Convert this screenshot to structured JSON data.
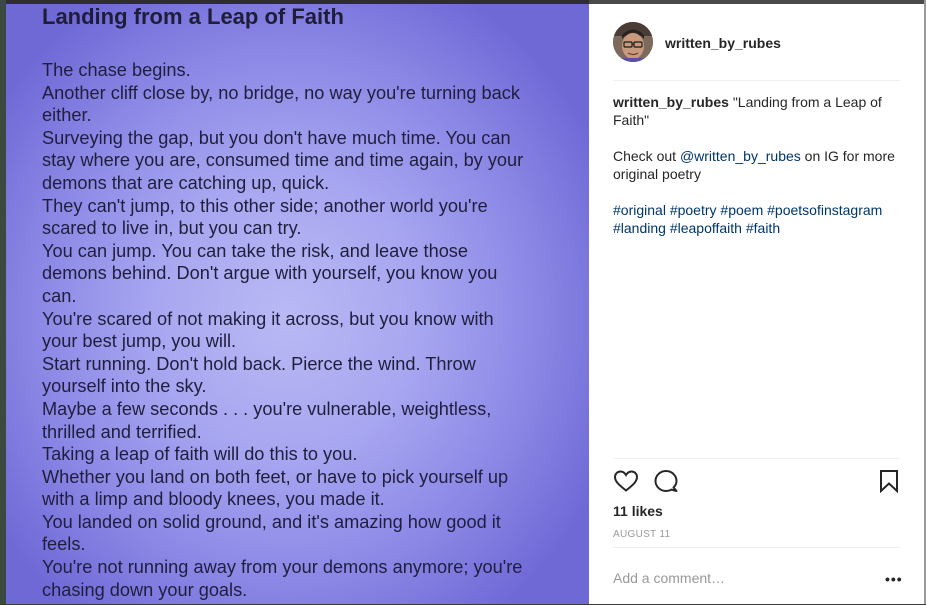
{
  "poem": {
    "title": "Landing from a Leap of Faith",
    "lines": [
      "The chase begins.",
      "Another cliff close by, no bridge, no way you're turning back",
      "either.",
      "Surveying the gap, but you don't have much time. You can",
      "stay where you are, consumed time and time again, by your",
      "demons that are catching up, quick.",
      "They can't jump, to this other side; another world you're",
      "scared to live in, but you can try.",
      "You can jump. You can take the risk, and leave those",
      "demons behind. Don't argue with yourself, you know you",
      "can.",
      "You're scared of not making it across, but you know with",
      "your best jump, you will.",
      "Start running.  Don't hold back. Pierce the wind. Throw",
      "yourself into the sky.",
      "Maybe a few seconds . . . you're vulnerable, weightless,",
      "thrilled and terrified.",
      "Taking a leap of faith will do this to you.",
      "Whether you land on both feet, or have to pick yourself up",
      "with a limp and bloody knees, you made it.",
      "You landed on solid ground, and it's amazing how good it",
      "feels.",
      "You're not running away from your demons anymore; you're",
      "chasing down your goals."
    ]
  },
  "post": {
    "username": "written_by_rubes",
    "caption": {
      "user": "written_by_rubes",
      "title_text": " \"Landing from a Leap of Faith\"",
      "check_prefix": "Check out ",
      "mention": "@written_by_rubes",
      "check_suffix": " on IG for more original poetry",
      "hashtags": [
        "#original",
        "#poetry",
        "#poem",
        "#poetsofinstagram",
        "#landing",
        "#leapoffaith",
        "#faith"
      ]
    },
    "likes": "11 likes",
    "date": "AUGUST 11",
    "comment_placeholder": "Add a comment…",
    "more_label": "•••"
  },
  "icons": {
    "like": "heart-icon",
    "comment": "comment-icon",
    "save": "bookmark-icon"
  },
  "colors": {
    "link": "#003569",
    "text": "#262626",
    "muted": "#999999",
    "poem_background": "#a7a6f0"
  }
}
